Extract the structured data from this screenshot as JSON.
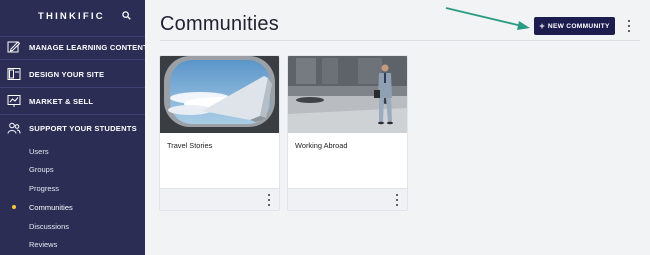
{
  "sidebar": {
    "brand": "THINKIFIC",
    "nav": [
      {
        "label": "MANAGE LEARNING CONTENT",
        "icon": "edit-content-icon"
      },
      {
        "label": "DESIGN YOUR SITE",
        "icon": "layout-icon"
      },
      {
        "label": "MARKET & SELL",
        "icon": "chart-icon"
      },
      {
        "label": "SUPPORT YOUR STUDENTS",
        "icon": "students-icon"
      }
    ],
    "sub_items": [
      {
        "label": "Users",
        "active": false
      },
      {
        "label": "Groups",
        "active": false
      },
      {
        "label": "Progress",
        "active": false
      },
      {
        "label": "Communities",
        "active": true
      },
      {
        "label": "Discussions",
        "active": false
      },
      {
        "label": "Reviews",
        "active": false
      }
    ]
  },
  "header": {
    "title": "Communities",
    "new_button_label": "NEW COMMUNITY"
  },
  "cards": [
    {
      "title": "Travel Stories",
      "image": "airplane-window-image"
    },
    {
      "title": "Working Abroad",
      "image": "businessman-walking-image"
    }
  ],
  "colors": {
    "sidebar": "#2b2d55",
    "button": "#1c1d4e",
    "active_dot": "#f5c542",
    "arrow": "#2a9b82"
  }
}
